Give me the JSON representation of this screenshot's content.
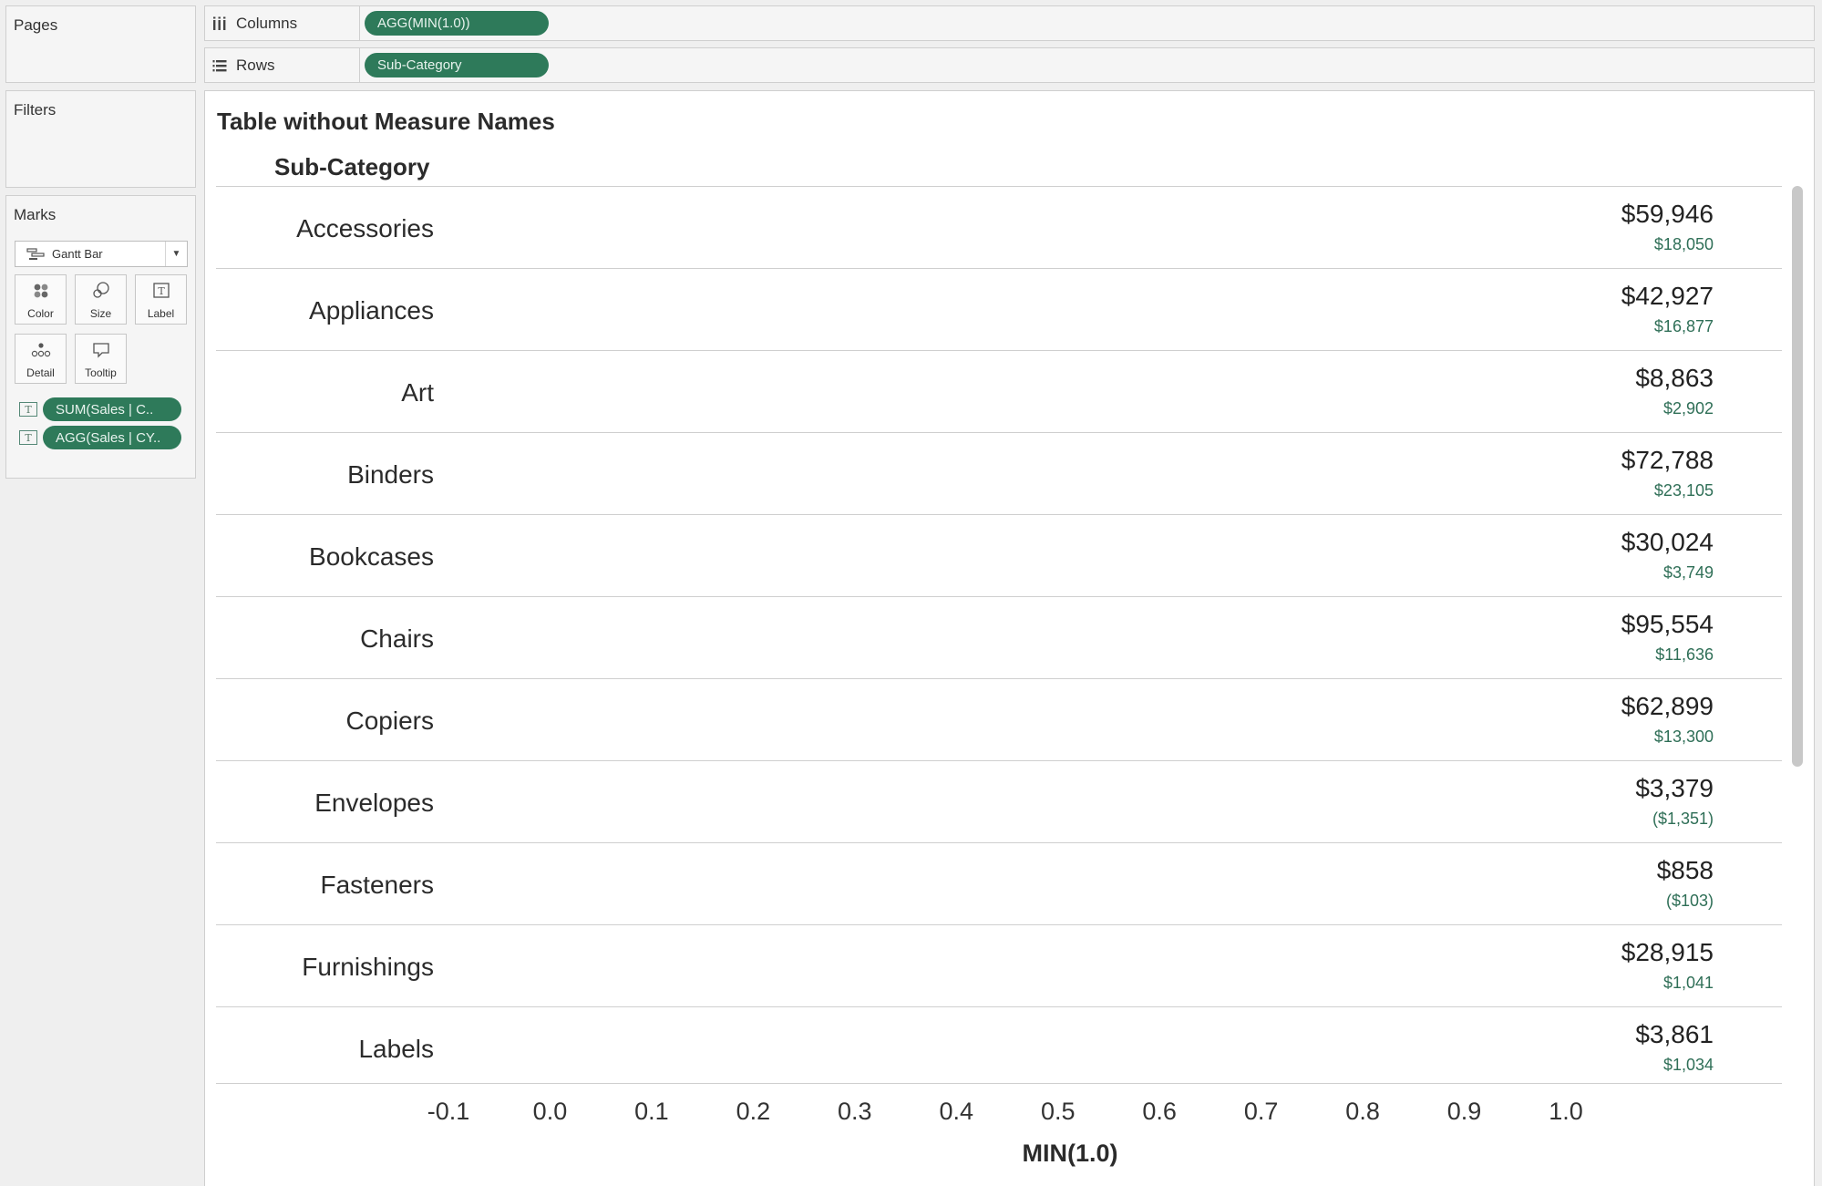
{
  "panels": {
    "pages": {
      "title": "Pages"
    },
    "filters": {
      "title": "Filters"
    },
    "marks": {
      "title": "Marks",
      "mark_type": "Gantt Bar",
      "buttons": {
        "color": "Color",
        "size": "Size",
        "label": "Label",
        "detail": "Detail",
        "tooltip": "Tooltip"
      },
      "fields": [
        {
          "icon": "T",
          "label": "SUM(Sales | C.."
        },
        {
          "icon": "T",
          "label": "AGG(Sales | CY.."
        }
      ]
    }
  },
  "shelves": {
    "columns": {
      "label": "Columns",
      "pill": "AGG(MIN(1.0))"
    },
    "rows": {
      "label": "Rows",
      "pill": "Sub-Category"
    }
  },
  "view": {
    "title": "Table without Measure Names",
    "column_header": "Sub-Category",
    "rows": [
      {
        "category": "Accessories",
        "value1": "$59,946",
        "value2": "$18,050"
      },
      {
        "category": "Appliances",
        "value1": "$42,927",
        "value2": "$16,877"
      },
      {
        "category": "Art",
        "value1": "$8,863",
        "value2": "$2,902"
      },
      {
        "category": "Binders",
        "value1": "$72,788",
        "value2": "$23,105"
      },
      {
        "category": "Bookcases",
        "value1": "$30,024",
        "value2": "$3,749"
      },
      {
        "category": "Chairs",
        "value1": "$95,554",
        "value2": "$11,636"
      },
      {
        "category": "Copiers",
        "value1": "$62,899",
        "value2": "$13,300"
      },
      {
        "category": "Envelopes",
        "value1": "$3,379",
        "value2": "($1,351)"
      },
      {
        "category": "Fasteners",
        "value1": "$858",
        "value2": "($103)"
      },
      {
        "category": "Furnishings",
        "value1": "$28,915",
        "value2": "$1,041"
      },
      {
        "category": "Labels",
        "value1": "$3,861",
        "value2": "$1,034"
      }
    ],
    "axis": {
      "title": "MIN(1.0)",
      "ticks": [
        "-0.1",
        "0.0",
        "0.1",
        "0.2",
        "0.3",
        "0.4",
        "0.5",
        "0.6",
        "0.7",
        "0.8",
        "0.9",
        "1.0"
      ],
      "range": [
        -0.1,
        1.0
      ]
    }
  },
  "colors": {
    "pill": "#2e7a5a",
    "secondary_value": "#2f6f57"
  }
}
